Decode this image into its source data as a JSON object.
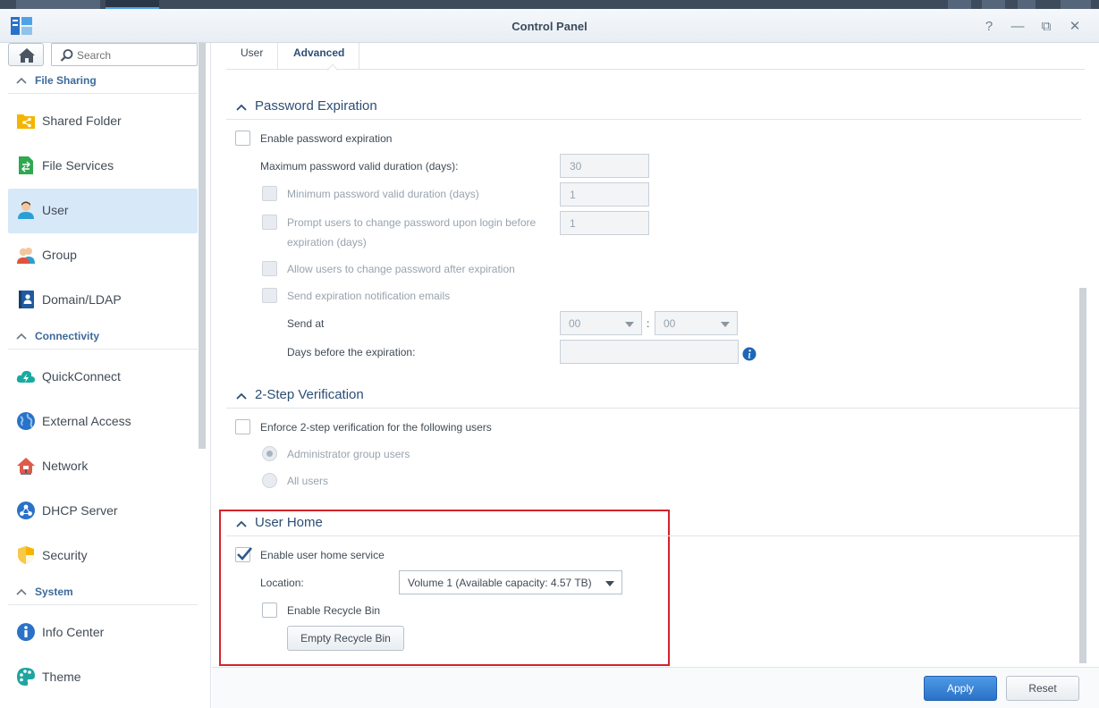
{
  "window": {
    "title": "Control Panel"
  },
  "sidebar": {
    "search_placeholder": "Search",
    "sections": [
      {
        "label": "File Sharing",
        "items": [
          {
            "label": "Shared Folder",
            "icon": "shared-folder-icon"
          },
          {
            "label": "File Services",
            "icon": "file-services-icon"
          },
          {
            "label": "User",
            "icon": "user-icon",
            "active": true
          },
          {
            "label": "Group",
            "icon": "group-icon"
          },
          {
            "label": "Domain/LDAP",
            "icon": "domain-ldap-icon"
          }
        ]
      },
      {
        "label": "Connectivity",
        "items": [
          {
            "label": "QuickConnect",
            "icon": "quickconnect-icon"
          },
          {
            "label": "External Access",
            "icon": "external-access-icon"
          },
          {
            "label": "Network",
            "icon": "network-icon"
          },
          {
            "label": "DHCP Server",
            "icon": "dhcp-server-icon"
          },
          {
            "label": "Security",
            "icon": "security-shield-icon"
          }
        ]
      },
      {
        "label": "System",
        "items": [
          {
            "label": "Info Center",
            "icon": "info-center-icon"
          },
          {
            "label": "Theme",
            "icon": "theme-palette-icon"
          }
        ]
      }
    ]
  },
  "tabs": [
    {
      "label": "User"
    },
    {
      "label": "Advanced",
      "active": true
    }
  ],
  "password_expiration": {
    "title": "Password Expiration",
    "enable_label": "Enable password expiration",
    "max_duration_label": "Maximum password valid duration (days):",
    "max_duration_value": "30",
    "min_duration_label": "Minimum password valid duration (days)",
    "min_duration_value": "1",
    "prompt_label_1": "Prompt users to change password upon login before",
    "prompt_label_2": "expiration (days)",
    "prompt_value": "1",
    "allow_change_label": "Allow users to change password after expiration",
    "send_notification_label": "Send expiration notification emails",
    "send_at_label": "Send at",
    "send_at_hour": "00",
    "send_at_sep": ":",
    "send_at_minute": "00",
    "days_before_label": "Days before the expiration:",
    "days_before_value": ""
  },
  "two_step": {
    "title": "2-Step Verification",
    "enforce_label": "Enforce 2-step verification for the following users",
    "admin_label": "Administrator group users",
    "all_label": "All users"
  },
  "user_home": {
    "title": "User Home",
    "enable_label": "Enable user home service",
    "enabled": true,
    "location_label": "Location:",
    "location_value": "Volume 1 (Available capacity:  4.57 TB)",
    "recycle_label": "Enable Recycle Bin",
    "empty_recycle_button": "Empty Recycle Bin"
  },
  "footer": {
    "apply": "Apply",
    "reset": "Reset"
  },
  "colors": {
    "accent": "#2d4e74",
    "highlight": "#d4232a",
    "primary_button": "#2a72c8"
  }
}
